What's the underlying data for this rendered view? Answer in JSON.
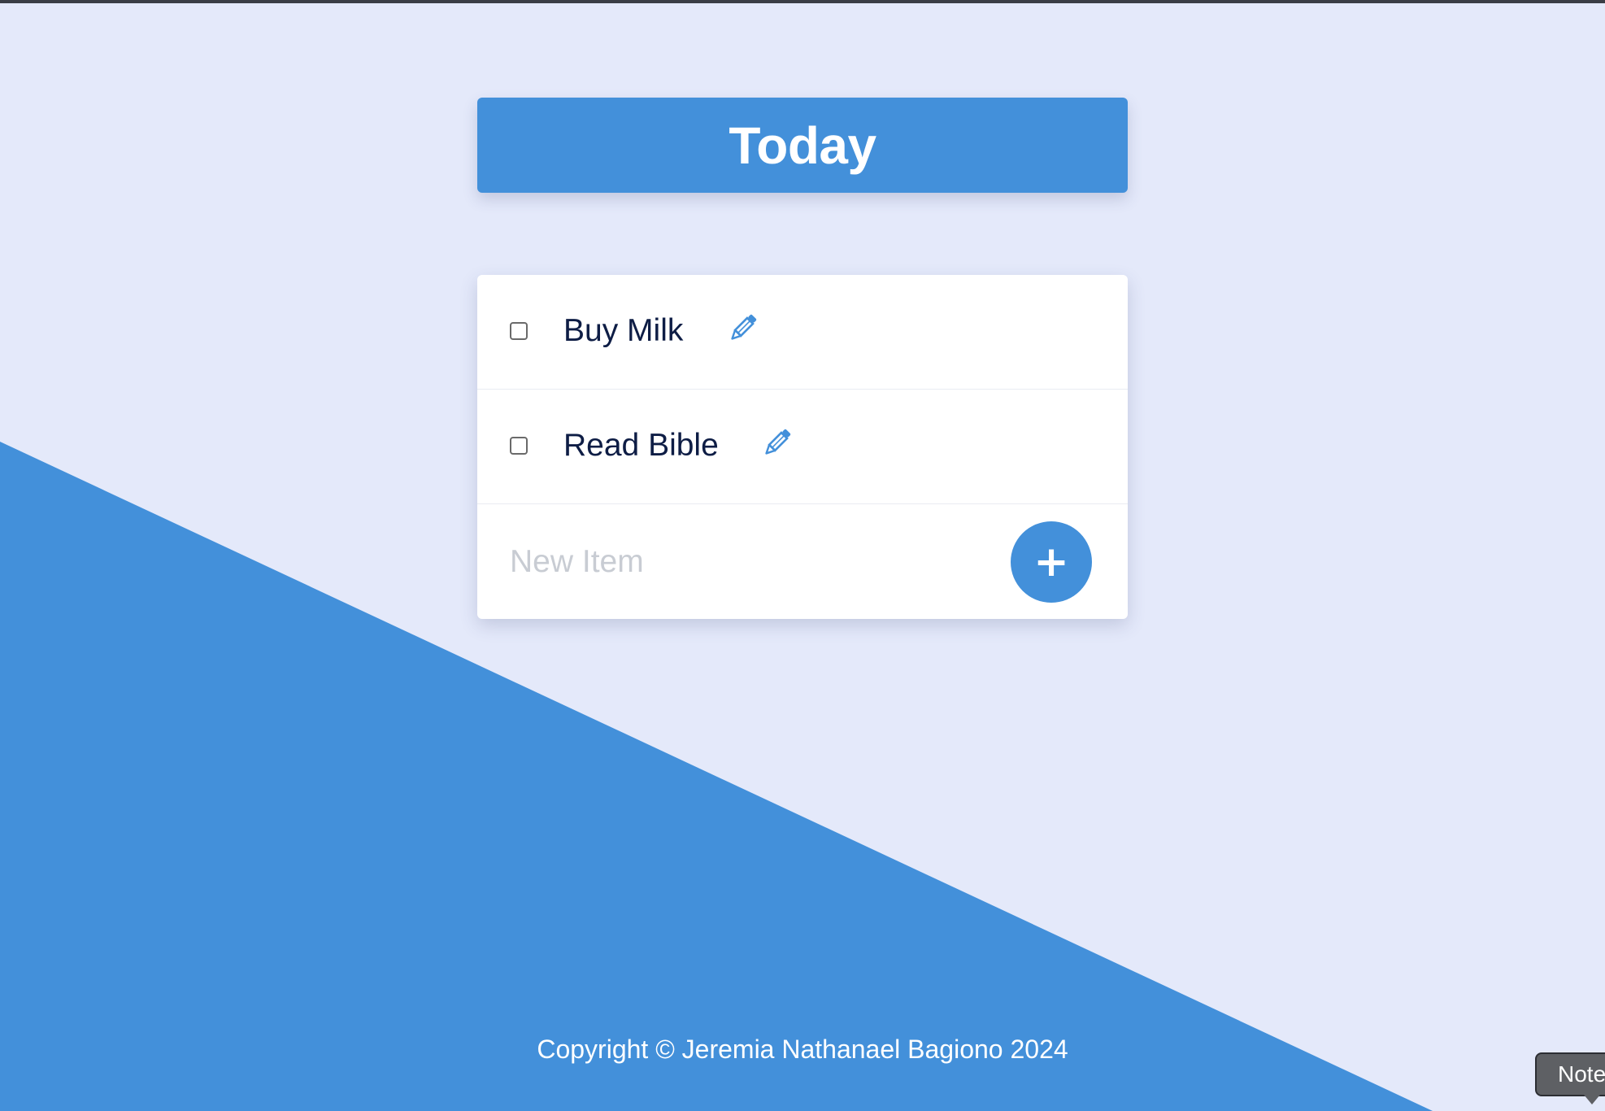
{
  "colors": {
    "accent": "#4390DA",
    "background": "#E4E9FA",
    "item_text": "#0E1D45"
  },
  "header": {
    "title": "Today"
  },
  "list": {
    "items": [
      {
        "label": "Buy Milk",
        "checked": false,
        "edit_icon": "pencil-icon"
      },
      {
        "label": "Read Bible",
        "checked": false,
        "edit_icon": "pencil-icon"
      }
    ]
  },
  "new_item": {
    "placeholder": "New Item",
    "value": "",
    "add_label": "+"
  },
  "footer": {
    "copyright": "Copyright © Jeremia Nathanael Bagiono 2024"
  },
  "tooltip": {
    "text": "Note"
  }
}
